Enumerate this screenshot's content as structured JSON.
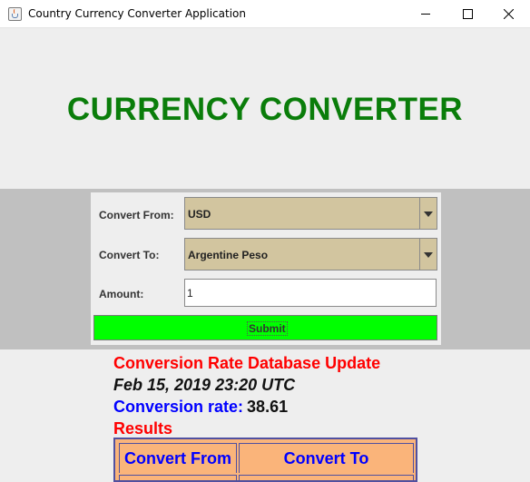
{
  "window": {
    "title": "Country Currency Converter Application"
  },
  "header": {
    "title": "CURRENCY CONVERTER"
  },
  "form": {
    "from_label": "Convert From:",
    "from_value": "USD",
    "to_label": "Convert To:",
    "to_value": "Argentine Peso",
    "amount_label": "Amount:",
    "amount_value": "1",
    "submit_label": "Submit"
  },
  "results": {
    "update_heading": "Conversion Rate Database Update",
    "update_time": "Feb 15, 2019 23:20 UTC",
    "rate_label": "Conversion rate:",
    "rate_value": "38.61",
    "results_heading": "Results",
    "columns": [
      "Convert From",
      "Convert To"
    ]
  },
  "colors": {
    "title_green": "#0a7d0a",
    "submit_green": "#00ff00",
    "combo_tan": "#d2c59f",
    "heading_red": "#ff0000",
    "label_blue": "#0000ff",
    "table_orange": "#fab47a"
  }
}
